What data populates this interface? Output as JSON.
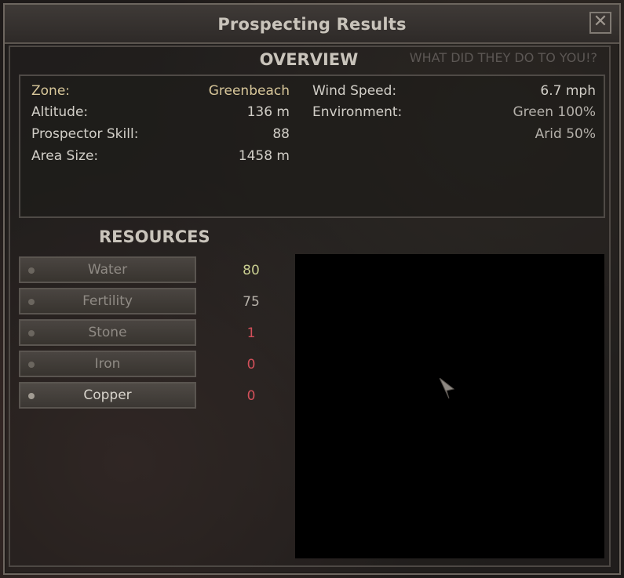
{
  "window": {
    "title": "Prospecting Results",
    "close_label": "✕"
  },
  "overview": {
    "title": "OVERVIEW",
    "flavor_text": "WHAT DID THEY DO TO YOU!?",
    "zone": {
      "label": "Zone:",
      "value": "Greenbeach"
    },
    "altitude": {
      "label": "Altitude:",
      "value": "136 m"
    },
    "prospector_skill": {
      "label": "Prospector Skill:",
      "value": "88"
    },
    "area_size": {
      "label": "Area Size:",
      "value": "1458 m"
    },
    "wind_speed": {
      "label": "Wind Speed:",
      "value": "6.7 mph"
    },
    "environment": {
      "label": "Environment:",
      "values": [
        "Green 100%",
        "Arid 50%"
      ]
    }
  },
  "resources": {
    "title": "RESOURCES",
    "items": [
      {
        "label": "Water",
        "value": "80",
        "color": "#c7cc8f"
      },
      {
        "label": "Fertility",
        "value": "75",
        "color": "#b8b3ab"
      },
      {
        "label": "Stone",
        "value": "1",
        "color": "#d2505a"
      },
      {
        "label": "Iron",
        "value": "0",
        "color": "#d2505a"
      },
      {
        "label": "Copper",
        "value": "0",
        "color": "#d2505a"
      }
    ],
    "selected": "Copper"
  },
  "colors": {
    "zone_value": "#d8c79a",
    "positive": "#c7cc8f",
    "negative": "#d2505a"
  }
}
